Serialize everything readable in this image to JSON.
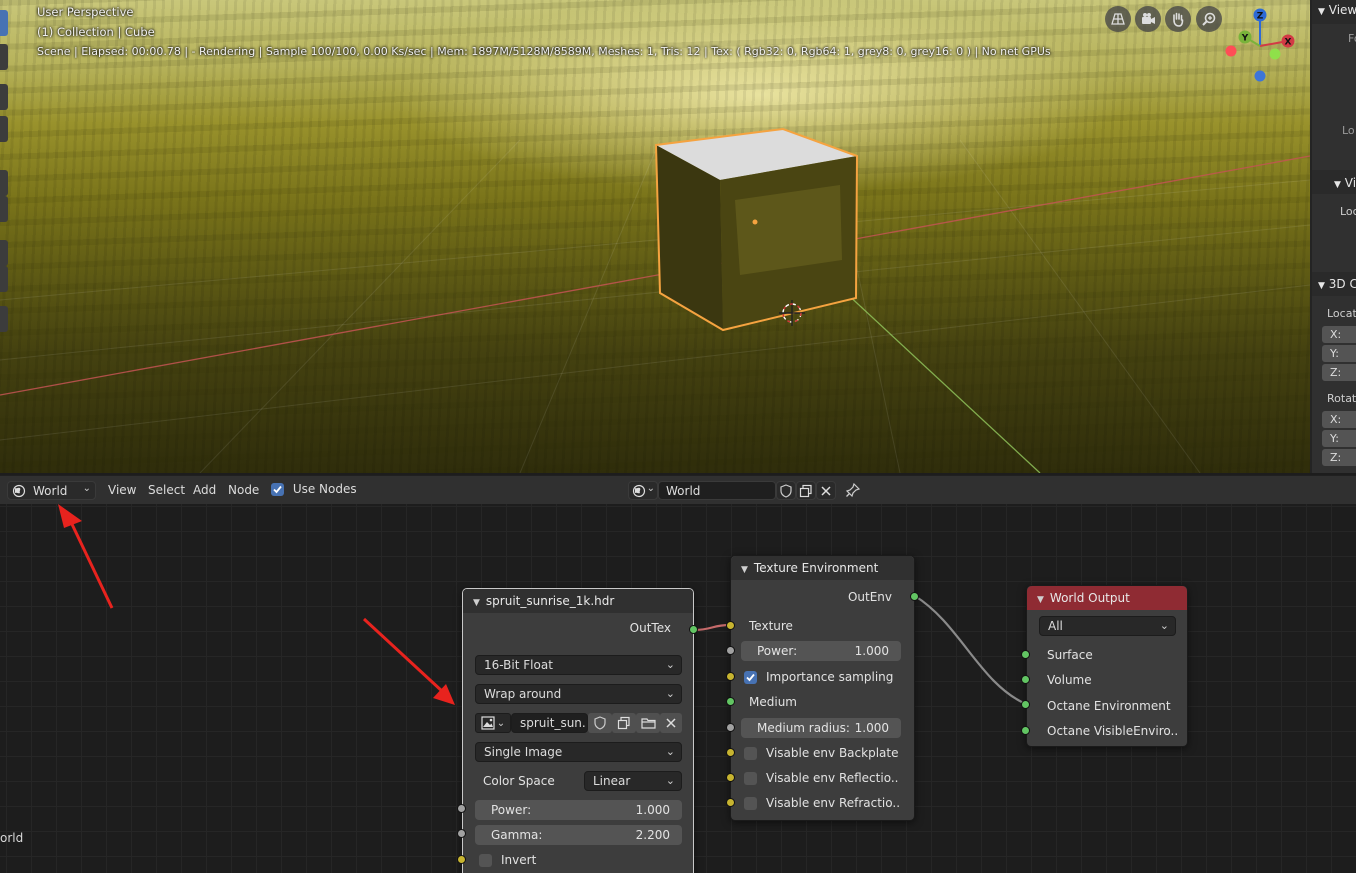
{
  "viewport": {
    "overlay": {
      "perspective": "User Perspective",
      "collection": "(1) Collection | Cube",
      "stats": "Scene | Elapsed: 00:00.78 |  - Rendering | Sample 100/100, 0.00 Ks/sec | Mem: 1897M/5128M/8589M, Meshes: 1, Tris: 12 | Tex: ( Rgb32: 0, Rgb64: 1, grey8: 0, grey16: 0 ) | No net GPUs"
    },
    "gizmo": {
      "x": "X",
      "y": "Y",
      "z": "Z"
    },
    "nav_icons": [
      "grid-view-icon",
      "camera-icon",
      "hand-pan-icon",
      "zoom-icon"
    ]
  },
  "properties_panel": {
    "view_header": "View",
    "view_label_fo": "Fo",
    "view_label_lo": "Lo",
    "view_lock_header": "Vi",
    "view_lock_label": "Loc",
    "cursor_header": "3D C",
    "location_label": "Locati",
    "rotation_label": "Rotati",
    "axis_x": "X:",
    "axis_y": "Y:",
    "axis_z": "Z:"
  },
  "node_header": {
    "editor_type": "World",
    "menu": {
      "view": "View",
      "select": "Select",
      "add": "Add",
      "node": "Node"
    },
    "use_nodes_label": "Use Nodes",
    "use_nodes_checked": true,
    "world_name": "World"
  },
  "side_label": "orld",
  "nodes": {
    "image": {
      "title": "spruit_sunrise_1k.hdr",
      "output": "OutTex",
      "bit_depth": "16-Bit Float",
      "wrap": "Wrap around",
      "image_name": "spruit_sun..",
      "source": "Single Image",
      "color_space_label": "Color Space",
      "color_space": "Linear",
      "power_label": "Power:",
      "power_value": "1.000",
      "gamma_label": "Gamma:",
      "gamma_value": "2.200",
      "invert_label": "Invert"
    },
    "texture_env": {
      "title": "Texture Environment",
      "output": "OutEnv",
      "texture": "Texture",
      "power_label": "Power:",
      "power_value": "1.000",
      "importance_label": "Importance sampling",
      "importance_checked": true,
      "medium": "Medium",
      "medium_radius_label": "Medium radius:",
      "medium_radius_value": "1.000",
      "backplate": "Visable env Backplate",
      "reflection": "Visable env Reflectio..",
      "refraction": "Visable env Refractio.."
    },
    "world_output": {
      "title": "World Output",
      "target": "All",
      "surface": "Surface",
      "volume": "Volume",
      "octane_env": "Octane Environment",
      "octane_visible": "Octane VisibleEnviro.."
    }
  },
  "colors": {
    "accent": "#4772b3",
    "selection_outline": "#f5a340",
    "world_output_header": "#8f2b33",
    "socket_green": "#62c563",
    "socket_grey": "#a1a1a1",
    "socket_yellow": "#c7b430",
    "annotation_arrow": "#e8231e"
  }
}
